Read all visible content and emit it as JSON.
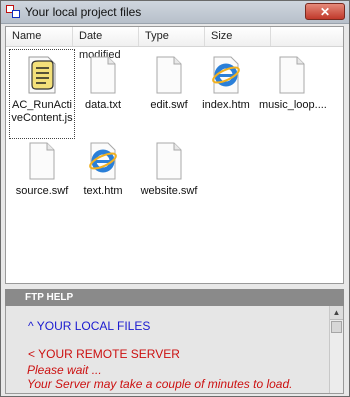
{
  "window": {
    "title": "Your local project files",
    "close_glyph": "✕"
  },
  "columns": [
    "Name",
    "Date modified",
    "Type",
    "Size"
  ],
  "files": [
    {
      "name": "AC_RunActiveContent.js",
      "icon": "script-file-icon"
    },
    {
      "name": "data.txt",
      "icon": "blank-file-icon"
    },
    {
      "name": "edit.swf",
      "icon": "blank-file-icon"
    },
    {
      "name": "index.htm",
      "icon": "internet-explorer-icon"
    },
    {
      "name": "music_loop....",
      "icon": "blank-file-icon"
    },
    {
      "name": "source.swf",
      "icon": "blank-file-icon"
    },
    {
      "name": "text.htm",
      "icon": "internet-explorer-icon"
    },
    {
      "name": "website.swf",
      "icon": "blank-file-icon"
    }
  ],
  "help": {
    "header": "FTP HELP",
    "local": "^   YOUR LOCAL FILES",
    "remote": "<   YOUR REMOTE SERVER",
    "wait": "Please wait ...",
    "load": "Your Server may take a couple of minutes to load."
  },
  "colors": {
    "local_text": "#1a1ad0",
    "remote_text": "#cc1111",
    "help_bar": "#8a8a8a"
  }
}
